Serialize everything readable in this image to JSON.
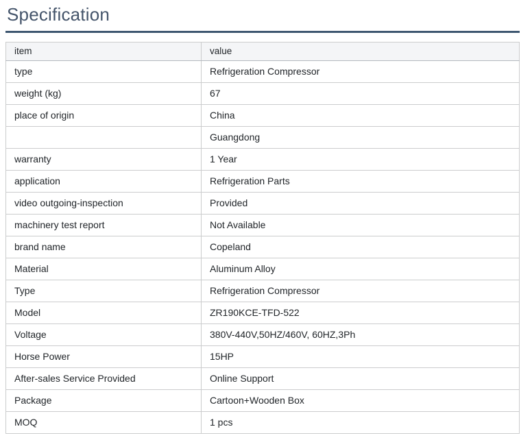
{
  "page": {
    "title": "Specification"
  },
  "table": {
    "columns": [
      "item",
      "value"
    ],
    "rows": [
      {
        "item": "type",
        "value": "Refrigeration Compressor"
      },
      {
        "item": "weight (kg)",
        "value": "67"
      },
      {
        "item": "place of origin",
        "value": "China"
      },
      {
        "item": "",
        "value": "Guangdong"
      },
      {
        "item": "warranty",
        "value": "1 Year"
      },
      {
        "item": "application",
        "value": "Refrigeration Parts"
      },
      {
        "item": "video outgoing-inspection",
        "value": "Provided"
      },
      {
        "item": "machinery test report",
        "value": "Not Available"
      },
      {
        "item": "brand name",
        "value": "Copeland"
      },
      {
        "item": "Material",
        "value": "Aluminum Alloy"
      },
      {
        "item": "Type",
        "value": "Refrigeration Compressor"
      },
      {
        "item": "Model",
        "value": "ZR190KCE-TFD-522"
      },
      {
        "item": "Voltage",
        "value": "380V-440V,50HZ/460V, 60HZ,3Ph"
      },
      {
        "item": "Horse Power",
        "value": "15HP"
      },
      {
        "item": "After-sales Service Provided",
        "value": "Online Support"
      },
      {
        "item": "Package",
        "value": "Cartoon+Wooden Box"
      },
      {
        "item": "MOQ",
        "value": "1 pcs"
      }
    ]
  },
  "colors": {
    "title": "#44546a",
    "rule": "#3e5771",
    "header_bg": "#f4f5f7",
    "border": "#cbcccd",
    "header_border": "#b4b8be",
    "text": "#212529",
    "page_bg": "#ffffff"
  }
}
